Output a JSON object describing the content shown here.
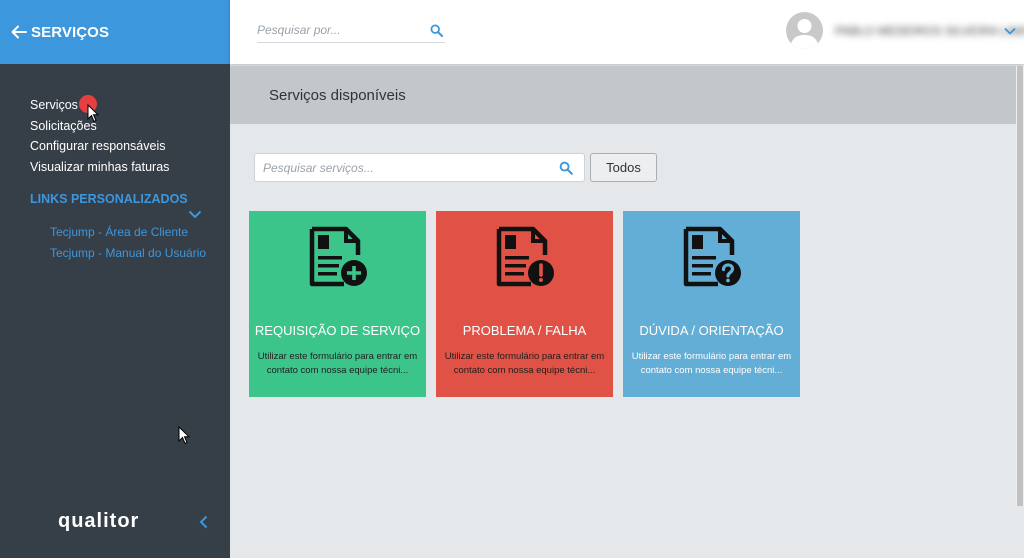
{
  "sidebar": {
    "header_title": "SERVIÇOS",
    "menu": [
      "Serviços",
      "Solicitações",
      "Configurar responsáveis",
      "Visualizar minhas faturas"
    ],
    "links_title": "LINKS PERSONALIZADOS",
    "custom_links": [
      "Tecjump - Área de Cliente",
      "Tecjump - Manual do Usuário"
    ],
    "logo": "qualitor"
  },
  "topbar": {
    "search_placeholder": "Pesquisar por...",
    "user_name": "PABLO MEDEIROS SILVEIRA LIMA"
  },
  "main": {
    "section_title": "Serviços disponíveis",
    "search_placeholder": "Pesquisar serviços...",
    "todos_label": "Todos",
    "cards": [
      {
        "title": "REQUISIÇÃO DE SERVIÇO",
        "desc": "Utilizar este formulário para entrar em contato com nossa equipe técni...",
        "icon": "document-plus-icon",
        "color": "#3cc58b"
      },
      {
        "title": "PROBLEMA / FALHA",
        "desc": "Utilizar este formulário para entrar em contato com nossa equipe técni...",
        "icon": "document-exclamation-icon",
        "color": "#e05245"
      },
      {
        "title": "DÚVIDA / ORIENTAÇÃO",
        "desc": "Utilizar este formulário para entrar em contato com nossa equipe técni...",
        "icon": "document-question-icon",
        "color": "#62aed6"
      }
    ]
  },
  "colors": {
    "accent": "#3d97dc",
    "sidebar_bg": "#363e48",
    "notification": "#e53f3f"
  }
}
